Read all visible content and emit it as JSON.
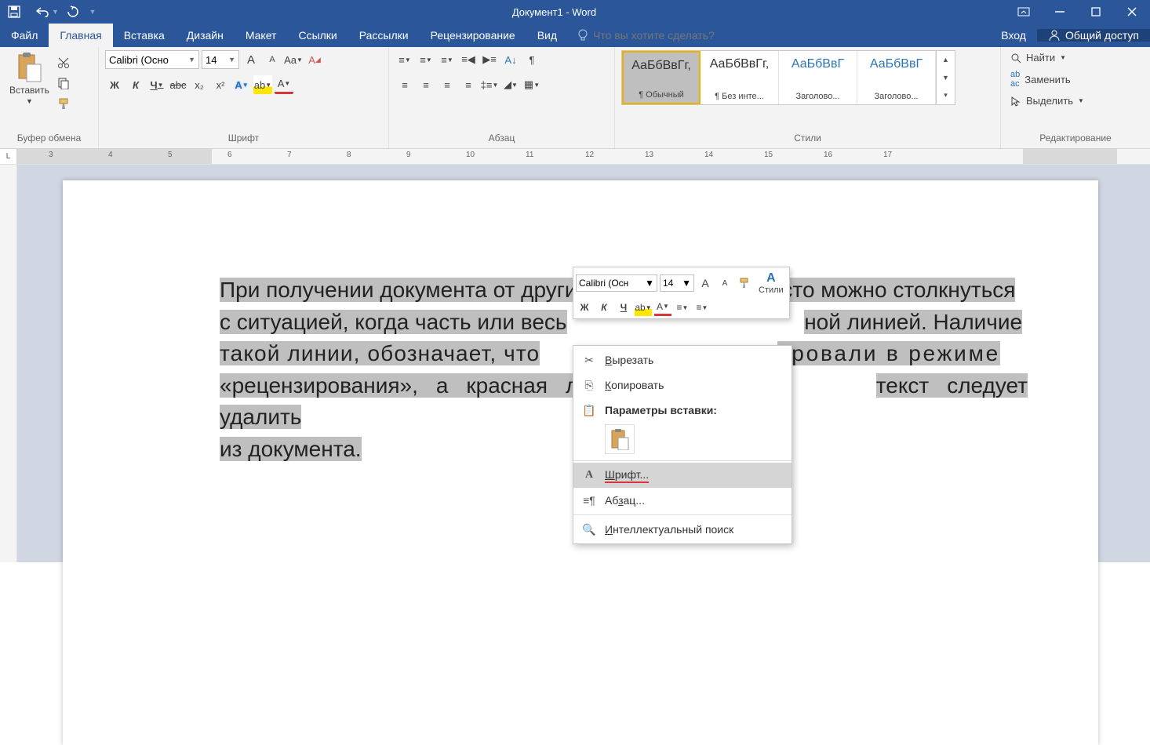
{
  "title": "Документ1 - Word",
  "tabs": {
    "file": "Файл",
    "home": "Главная",
    "insert": "Вставка",
    "design": "Дизайн",
    "layout": "Макет",
    "references": "Ссылки",
    "mailings": "Рассылки",
    "review": "Рецензирование",
    "view": "Вид"
  },
  "tell_me_placeholder": "Что вы хотите сделать?",
  "login": "Вход",
  "share": "Общий доступ",
  "groups": {
    "clipboard": "Буфер обмена",
    "font": "Шрифт",
    "paragraph": "Абзац",
    "styles": "Стили",
    "editing": "Редактирование"
  },
  "clipboard": {
    "paste": "Вставить"
  },
  "font": {
    "name": "Calibri (Осно",
    "size": "14",
    "bold": "Ж",
    "italic": "К",
    "underline": "Ч",
    "strike": "abc",
    "sub": "x₂",
    "sup": "x²",
    "effects": "A",
    "highlight": "ab",
    "color": "A",
    "grow": "A",
    "shrink": "A",
    "case": "Aa",
    "clear": "A"
  },
  "styles": [
    {
      "preview": "АаБбВвГг,",
      "name": "¶ Обычный"
    },
    {
      "preview": "АаБбВвГг,",
      "name": "¶ Без инте..."
    },
    {
      "preview": "АаБбВвГ",
      "name": "Заголово...",
      "color": "#2e74b5"
    },
    {
      "preview": "АаБбВвГ",
      "name": "Заголово...",
      "color": "#2e74b5"
    }
  ],
  "editing": {
    "find": "Найти",
    "replace": "Заменить",
    "select": "Выделить"
  },
  "mini": {
    "font": "Calibri (Осн",
    "size": "14",
    "styles": "Стили"
  },
  "ctx": {
    "cut": "Вырезать",
    "copy": "Копировать",
    "paste_header": "Параметры вставки:",
    "font": "Шрифт...",
    "paragraph": "Абзац...",
    "smart": "Интеллектуальный поиск"
  },
  "doc_lines": [
    "При получении документа от других пользователей, часто можно столкнуться",
    "с ситуацией, когда часть или весь",
    "ной линией. Наличие",
    "такой линии, обозначает, что",
    "ировали в режиме",
    "«рецензирования», а красная линя",
    "текст следует удалить",
    "из документа."
  ],
  "ruler": {
    "start": 3,
    "end": 17
  }
}
